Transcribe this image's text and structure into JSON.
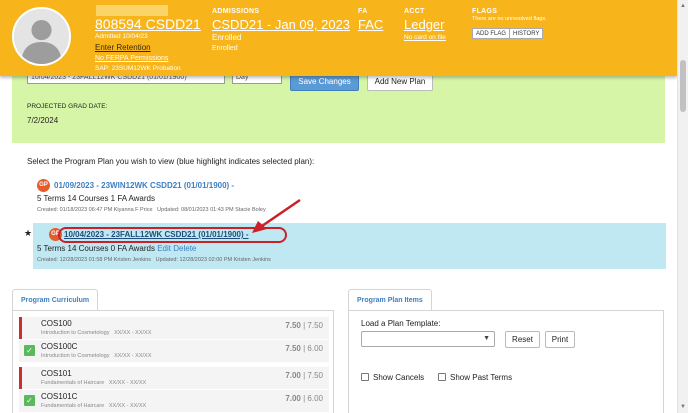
{
  "student": {
    "id_name": "808594 CSDD21",
    "admitted": "Admitted 10/04/23",
    "enter_retention": "Enter Retention",
    "ferpa": "No FERPA Permissions",
    "sap": "SAP: 23SUM12WK Probation"
  },
  "admissions": {
    "label": "ADMISSIONS",
    "value": "CSDD21 - Jan 09, 2023",
    "status": "Enrolled",
    "status2": "Enrolled"
  },
  "fa": {
    "label": "FA",
    "value": "FAC"
  },
  "acct": {
    "label": "ACCT",
    "value": "Ledger",
    "card": "No card on file"
  },
  "flags": {
    "label": "FLAGS",
    "note": "There are no unresolved flags.",
    "add_flag": "ADD FLAG",
    "history": "HISTORY"
  },
  "plan_panel": {
    "select_value": "10/04/2023 - 23FALL12WK CSDD21 (01/01/1900)",
    "small_select_value": "Day",
    "save": "Save Changes",
    "add_new_plan": "Add New Plan",
    "grad_label": "PROJECTED GRAD DATE:",
    "grad_value": "7/2/2024"
  },
  "plans": {
    "instruction": "Select the Program Plan you wish to view (blue highlight indicates selected plan):",
    "gp": "GP",
    "star": "★",
    "items": [
      {
        "title": "01/09/2023 - 23WIN12WK CSDD21 (01/01/1900) -",
        "summary": "5 Terms 14 Courses 1 FA Awards",
        "created": "Created: 01/18/2023 06:47 PM Kiyanna F Price",
        "updated": "Updated: 08/01/2023 01:43 PM Stacie Boley"
      },
      {
        "title": "10/04/2023 - 23FALL12WK CSDD21 (01/01/1900) -",
        "summary": "5 Terms 14 Courses 0 FA Awards",
        "edit": "Edit",
        "delete": "Delete",
        "created": "Created: 12/28/2023 01:58 PM Kristen Jenkins",
        "updated": "Updated: 12/28/2023 02:00 PM Kristen Jenkins"
      }
    ]
  },
  "curriculum": {
    "tab": "Program Curriculum",
    "courses": [
      {
        "code": "COS100",
        "name": "Introduction to Cosmetology",
        "dates": "XX/XX - XX/XX",
        "credits": "7.50",
        "total": "7.50",
        "status": "red"
      },
      {
        "code": "COS100C",
        "name": "Introduction to Cosmetology",
        "dates": "XX/XX - XX/XX",
        "credits": "7.50",
        "total": "6.00",
        "status": "check"
      },
      {
        "code": "COS101",
        "name": "Fundamentals of Haircare",
        "dates": "XX/XX - XX/XX",
        "credits": "7.00",
        "total": "7.50",
        "status": "red"
      },
      {
        "code": "COS101C",
        "name": "Fundamentals of Haircare",
        "dates": "XX/XX - XX/XX",
        "credits": "7.00",
        "total": "6.00",
        "status": "check"
      }
    ]
  },
  "plan_items": {
    "tab": "Program Plan Items",
    "load_label": "Load a Plan Template:",
    "reset": "Reset",
    "print": "Print",
    "show_cancels": "Show Cancels",
    "show_past_terms": "Show Past Terms"
  },
  "colors": {
    "header": "#f8b51b",
    "green_panel": "#d7f5a6",
    "selected_plan": "#bfe8f2",
    "link_blue": "#3e7fc1",
    "annotation_red": "#cc1f27"
  }
}
